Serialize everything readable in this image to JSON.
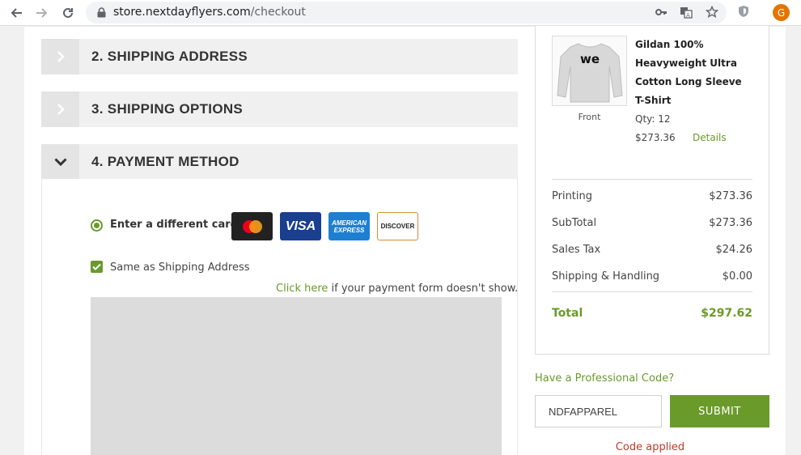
{
  "browser": {
    "url_host": "store.nextdayflyers.com",
    "url_path": "/checkout",
    "avatar_letter": "G"
  },
  "sections": [
    {
      "label": "2. SHIPPING ADDRESS",
      "state": "collapsed"
    },
    {
      "label": "3. SHIPPING OPTIONS",
      "state": "collapsed"
    },
    {
      "label": "4. PAYMENT METHOD",
      "state": "expanded"
    }
  ],
  "payment": {
    "option_label": "Enter a different card",
    "cards": [
      {
        "name": "mastercard-icon",
        "text": ""
      },
      {
        "name": "visa-icon",
        "text": "VISA"
      },
      {
        "name": "amex-icon",
        "text": "AMERICAN EXPRESS"
      },
      {
        "name": "discover-icon",
        "text": "DISCOVER"
      }
    ],
    "same_as_shipping": "Same as Shipping Address",
    "click_link": "Click here",
    "click_suffix": " if your payment form doesn't show."
  },
  "summary": {
    "product": {
      "name": "Gildan 100% Heavyweight Ultra Cotton Long Sleeve T-Shirt",
      "image_caption": "Front",
      "shirt_logo": "we",
      "qty": "Qty: 12",
      "price": "$273.36",
      "details_link": "Details"
    },
    "rows": [
      {
        "label": "Printing",
        "value": "$273.36"
      },
      {
        "label": "SubTotal",
        "value": "$273.36"
      },
      {
        "label": "Sales Tax",
        "value": "$24.26"
      },
      {
        "label": "Shipping & Handling",
        "value": "$0.00"
      }
    ],
    "total_label": "Total",
    "total_value": "$297.62"
  },
  "promo": {
    "label": "Have a Professional Code?",
    "code_value": "NDFAPPAREL",
    "submit_label": "SUBMIT",
    "status": "Code applied"
  },
  "colors": {
    "accent": "#6a9a2a",
    "error": "#c0392b"
  }
}
